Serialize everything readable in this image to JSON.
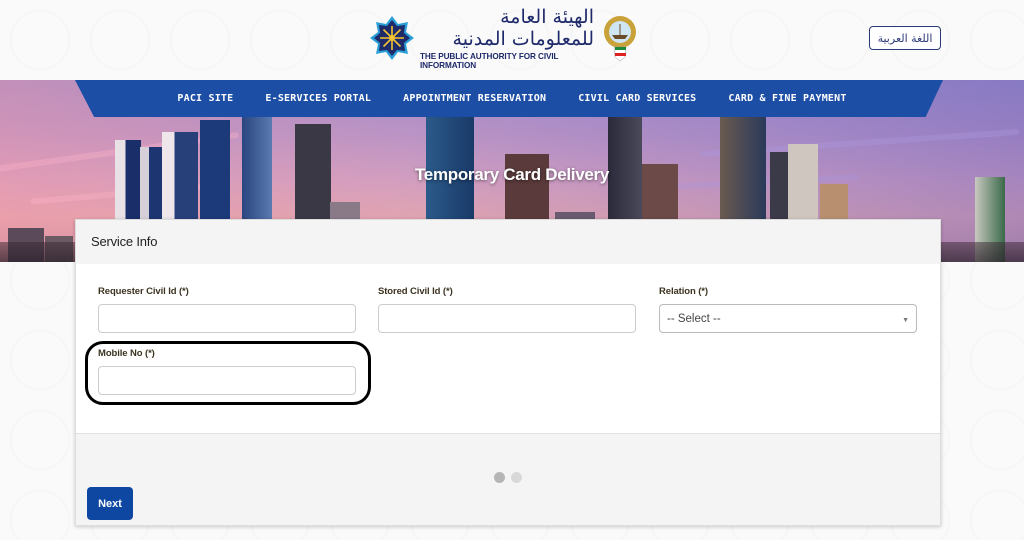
{
  "header": {
    "logo": {
      "arabic_name": "الهيئة العامة للمعلومات المدنية",
      "english_name": "THE PUBLIC AUTHORITY FOR CIVIL INFORMATION",
      "emblem_icon": "paci-star-emblem-icon",
      "state_emblem_icon": "kuwait-coat-of-arms-icon"
    },
    "language_toggle_label": "اللغة العربية"
  },
  "nav": {
    "items": [
      {
        "label": "PACI SITE"
      },
      {
        "label": "E-SERVICES PORTAL"
      },
      {
        "label": "APPOINTMENT RESERVATION"
      },
      {
        "label": "CIVIL CARD SERVICES"
      },
      {
        "label": "CARD & FINE PAYMENT"
      }
    ]
  },
  "banner": {
    "title": "Temporary Card Delivery"
  },
  "form": {
    "section_title": "Service Info",
    "fields": {
      "requester_civil_id": {
        "label": "Requester Civil Id (*)",
        "value": ""
      },
      "stored_civil_id": {
        "label": "Stored Civil Id (*)",
        "value": ""
      },
      "relation": {
        "label": "Relation (*)",
        "selected": "-- Select --"
      },
      "mobile_no": {
        "label": "Mobile No (*)",
        "value": ""
      }
    },
    "steps": {
      "current": 1,
      "total": 2
    },
    "next_label": "Next"
  },
  "colors": {
    "nav_blue": "#1c4ea6",
    "button_blue": "#0e47a1",
    "logo_navy": "#1f2a6b"
  }
}
